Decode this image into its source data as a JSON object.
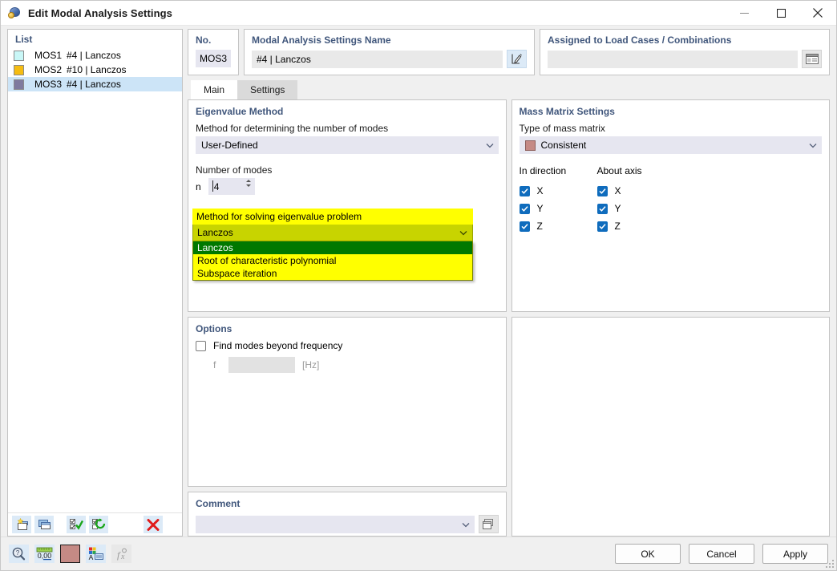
{
  "window": {
    "title": "Edit Modal Analysis Settings",
    "icon": "modal-analysis-icon",
    "minimize_label": "–",
    "maximize_label": "□",
    "close_label": "✕"
  },
  "list": {
    "header": "List",
    "items": [
      {
        "color": "#c9f7f7",
        "id": "MOS1",
        "name": "#4 | Lanczos",
        "selected": false
      },
      {
        "color": "#f5bc12",
        "id": "MOS2",
        "name": "#10 | Lanczos",
        "selected": false
      },
      {
        "color": "#7f7a9e",
        "id": "MOS3",
        "name": "#4 | Lanczos",
        "selected": true
      }
    ],
    "toolbar": [
      {
        "name": "new-item-button",
        "icon": "new-window-star-icon"
      },
      {
        "name": "copy-item-button",
        "icon": "copy-window-icon"
      },
      {
        "name": "select-all-button",
        "icon": "checklist-check-icon"
      },
      {
        "name": "refresh-selection-button",
        "icon": "checklist-refresh-icon"
      },
      {
        "name": "delete-item-button",
        "icon": "red-x-icon"
      }
    ]
  },
  "header": {
    "no_label": "No.",
    "no_value": "MOS3",
    "name_label": "Modal Analysis Settings Name",
    "name_value": "#4 | Lanczos",
    "name_edit_icon": "edit-pencil-icon",
    "assigned_label": "Assigned to Load Cases / Combinations",
    "assigned_value": "",
    "assigned_icon": "table-list-icon"
  },
  "tabs": [
    {
      "label": "Main",
      "active": true
    },
    {
      "label": "Settings",
      "active": false
    }
  ],
  "eigenvalue": {
    "panel_title": "Eigenvalue Method",
    "method_modes_label": "Method for determining the number of modes",
    "method_modes_value": "User-Defined",
    "number_of_modes_label": "Number of modes",
    "n_label": "n",
    "n_value": "4",
    "solve_label": "Method for solving eigenvalue problem",
    "solve_value": "Lanczos",
    "solve_options": [
      {
        "label": "Lanczos",
        "selected": true
      },
      {
        "label": "Root of characteristic polynomial",
        "selected": false
      },
      {
        "label": "Subspace iteration",
        "selected": false
      }
    ],
    "highlight_color": "#ffff00",
    "selected_option_color": "#007800"
  },
  "mass_matrix": {
    "panel_title": "Mass Matrix Settings",
    "type_label": "Type of mass matrix",
    "type_value": "Consistent",
    "type_swatch_color": "#c58a85",
    "in_direction_label": "In direction",
    "about_axis_label": "About axis",
    "in_direction": [
      {
        "label": "X",
        "checked": true
      },
      {
        "label": "Y",
        "checked": true
      },
      {
        "label": "Z",
        "checked": true
      }
    ],
    "about_axis": [
      {
        "label": "X",
        "checked": true
      },
      {
        "label": "Y",
        "checked": true
      },
      {
        "label": "Z",
        "checked": true
      }
    ],
    "checkbox_color": "#0f6cbd"
  },
  "options": {
    "panel_title": "Options",
    "find_modes_label": "Find modes beyond frequency",
    "find_modes_checked": false,
    "f_label": "f",
    "f_value": "",
    "f_unit": "[Hz]"
  },
  "comment": {
    "panel_title": "Comment",
    "value": "",
    "icon": "copy-comment-icon"
  },
  "footer": {
    "icons": [
      {
        "name": "help-magnifier-button",
        "icon": "magnifier-question-icon"
      },
      {
        "name": "decimal-places-button",
        "icon": "decimal-0-00-icon",
        "label": "0,00"
      },
      {
        "name": "color-swatch-button",
        "icon": "color-swatch-icon",
        "color": "#c58a85"
      },
      {
        "name": "display-properties-button",
        "icon": "font-color-icon"
      },
      {
        "name": "formula-button",
        "icon": "fx-formula-icon",
        "disabled": true
      }
    ],
    "buttons": [
      {
        "label": "OK",
        "name": "ok-button"
      },
      {
        "label": "Cancel",
        "name": "cancel-button"
      },
      {
        "label": "Apply",
        "name": "apply-button"
      }
    ]
  }
}
